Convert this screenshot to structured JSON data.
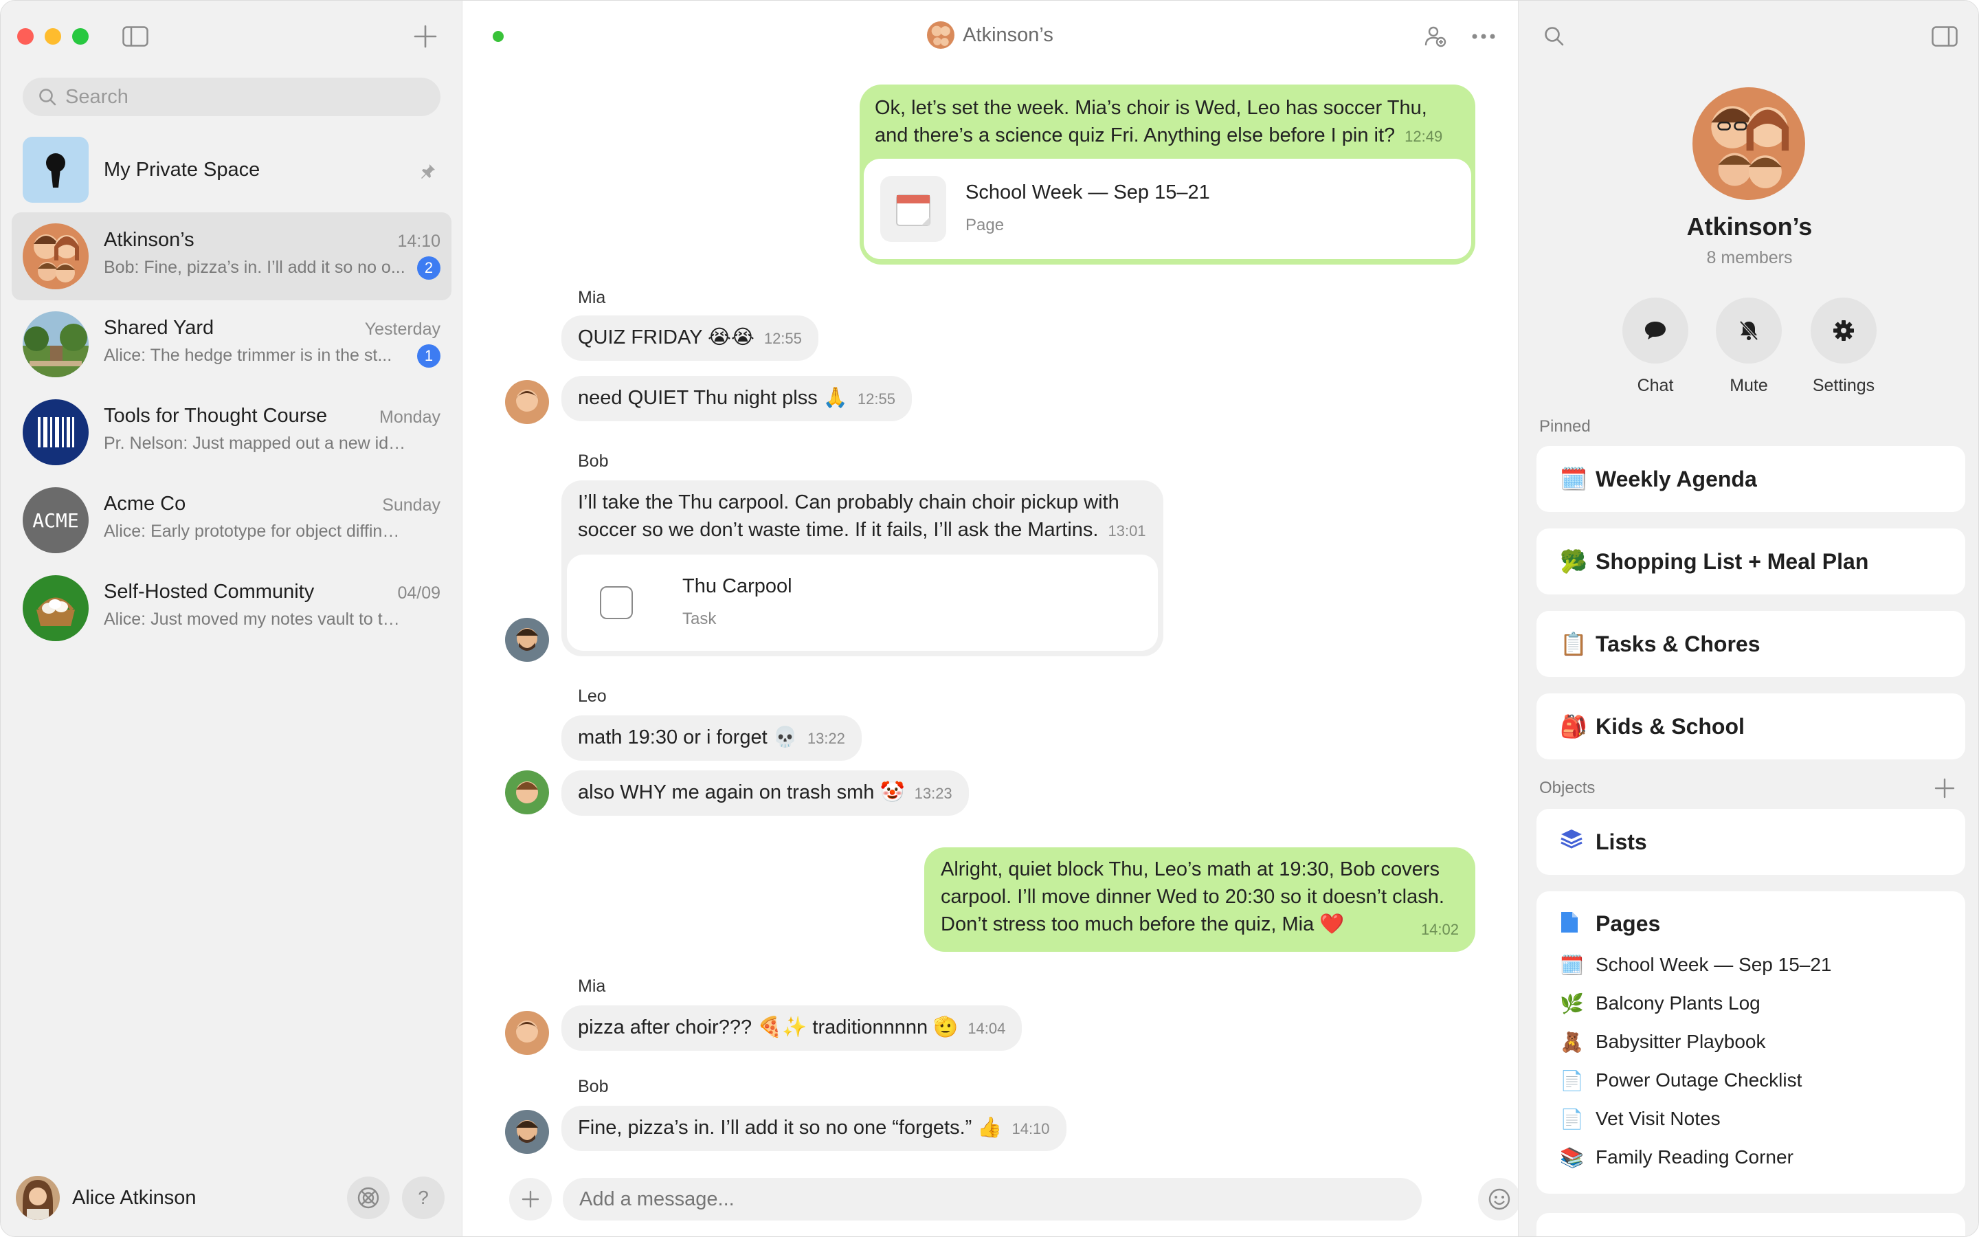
{
  "sidebar": {
    "search_placeholder": "Search",
    "private_space": "My Private Space",
    "chats": [
      {
        "name": "Atkinson’s",
        "time": "14:10",
        "preview": "Bob: Fine, pizza’s in. I’ll add it so no o...",
        "badge": "2"
      },
      {
        "name": "Shared Yard",
        "time": "Yesterday",
        "preview": "Alice: The hedge trimmer is in the st...",
        "badge": "1"
      },
      {
        "name": "Tools for Thought Course",
        "time": "Monday",
        "preview": "Pr. Nelson: Just mapped out a new idea s..."
      },
      {
        "name": "Acme Co",
        "time": "Sunday",
        "preview": "Alice: Early prototype for object diffing is...",
        "logo": "ACME"
      },
      {
        "name": "Self-Hosted Community",
        "time": "04/09",
        "preview": "Alice: Just moved my notes vault to the n..."
      }
    ],
    "user_name": "Alice Atkinson",
    "help": "?"
  },
  "chat": {
    "title": "Atkinson’s",
    "messages": {
      "m1_text": "Ok, let’s set the week. Mia’s choir is Wed, Leo has soccer Thu, and there’s a science quiz Fri. Anything else before I pin it?",
      "m1_time": "12:49",
      "m1_card_title": "School Week — Sep 15–21",
      "m1_card_type": "Page",
      "mia1_sender": "Mia",
      "m2_text": "QUIZ FRIDAY 😭😭",
      "m2_time": "12:55",
      "m3_text": "need QUIET Thu night plss 🙏",
      "m3_time": "12:55",
      "bob1_sender": "Bob",
      "m4_text": "I’ll take the Thu carpool. Can probably chain choir pickup with soccer so we don’t waste time. If it fails, I’ll ask the Martins.",
      "m4_time": "13:01",
      "m4_card_title": "Thu Carpool",
      "m4_card_type": "Task",
      "leo_sender": "Leo",
      "m5_text": "math 19:30 or i forget 💀",
      "m5_time": "13:22",
      "m6_text": "also WHY me again on trash smh 🤡",
      "m6_time": "13:23",
      "m7_text": "Alright, quiet block Thu, Leo’s math at 19:30, Bob covers carpool. I’ll move dinner Wed to 20:30 so it doesn’t clash. Don’t stress too much before the quiz, Mia ❤️",
      "m7_time": "14:02",
      "mia2_sender": "Mia",
      "m8_text": "pizza after choir??? 🍕✨ traditionnnnn 🫡",
      "m8_time": "14:04",
      "bob2_sender": "Bob",
      "m9_text": "Fine, pizza’s in. I’ll add it so no one “forgets.” 👍",
      "m9_time": "14:10"
    },
    "composer_placeholder": "Add a message..."
  },
  "right": {
    "group_name": "Atkinson’s",
    "members": "8 members",
    "actions": [
      "Chat",
      "Mute",
      "Settings"
    ],
    "pinned_label": "Pinned",
    "pinned": [
      {
        "emoji": "🗓️",
        "title": "Weekly Agenda"
      },
      {
        "emoji": "🥦",
        "title": "Shopping List + Meal Plan"
      },
      {
        "emoji": "📋",
        "title": "Tasks & Chores"
      },
      {
        "emoji": "🎒",
        "title": "Kids & School"
      }
    ],
    "objects_label": "Objects",
    "lists_label": "Lists",
    "pages_label": "Pages",
    "pages": [
      {
        "emoji": "🗓️",
        "title": "School Week — Sep 15–21"
      },
      {
        "emoji": "🌿",
        "title": "Balcony Plants Log"
      },
      {
        "emoji": "🧸",
        "title": "Babysitter Playbook"
      },
      {
        "emoji": "📄",
        "title": "Power Outage Checklist"
      },
      {
        "emoji": "📄",
        "title": "Vet Visit Notes"
      },
      {
        "emoji": "📚",
        "title": "Family Reading Corner"
      }
    ]
  }
}
